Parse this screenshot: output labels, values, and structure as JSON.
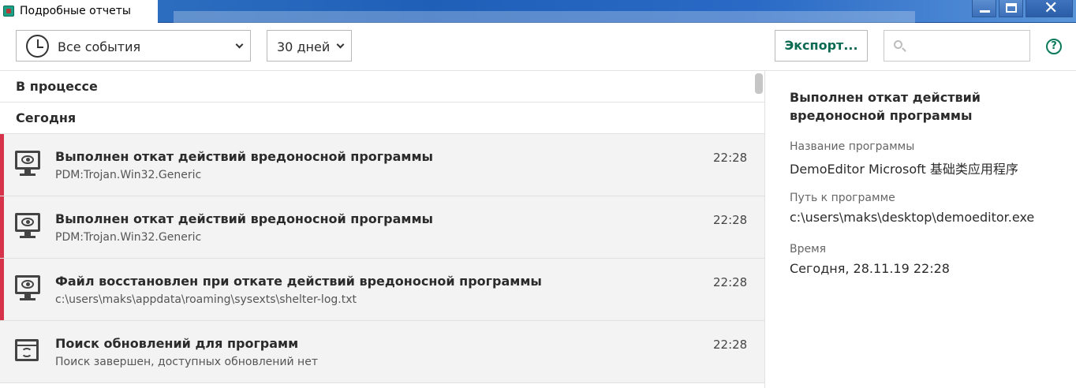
{
  "window": {
    "title": "Подробные отчеты",
    "close_glyph": "✕"
  },
  "toolbar": {
    "event_filter": "Все события",
    "period_filter": "30 дней",
    "export_label": "Экспорт...",
    "search_placeholder": "",
    "help_glyph": "?"
  },
  "groups": [
    {
      "label": "В процессе"
    },
    {
      "label": "Сегодня"
    }
  ],
  "events": [
    {
      "icon": "monitor-eye-icon",
      "title": "Выполнен откат действий вредоносной программы",
      "subtitle": "PDM:Trojan.Win32.Generic",
      "time": "22:28",
      "severity": "threat"
    },
    {
      "icon": "monitor-eye-icon",
      "title": "Выполнен откат действий вредоносной программы",
      "subtitle": "PDM:Trojan.Win32.Generic",
      "time": "22:28",
      "severity": "threat"
    },
    {
      "icon": "monitor-eye-icon",
      "title": "Файл восстановлен при откате действий вредоносной программы",
      "subtitle": "c:\\users\\maks\\appdata\\roaming\\sysexts\\shelter-log.txt",
      "time": "22:28",
      "severity": "threat"
    },
    {
      "icon": "update-icon",
      "title": "Поиск обновлений для программ",
      "subtitle": "Поиск завершен, доступных обновлений нет",
      "time": "22:28",
      "severity": "info"
    }
  ],
  "detail": {
    "title": "Выполнен откат действий вредоносной программы",
    "fields": [
      {
        "label": "Название программы",
        "value": "DemoEditor Microsoft 基础类应用程序"
      },
      {
        "label": "Путь к программе",
        "value": "c:\\users\\maks\\desktop\\demoeditor.exe"
      },
      {
        "label": "Время",
        "value": "Сегодня, 28.11.19 22:28"
      }
    ]
  },
  "colors": {
    "accent": "#0b6b52",
    "threat": "#d6334a",
    "titlebar": "#2f6fc0"
  }
}
